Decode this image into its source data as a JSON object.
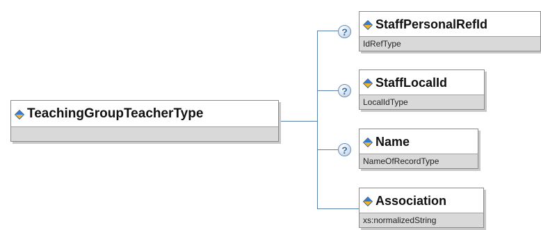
{
  "root": {
    "name": "TeachingGroupTeacherType",
    "icon": "element-icon"
  },
  "children": [
    {
      "name": "StaffPersonalRefId",
      "type": "IdRefType",
      "optional": true
    },
    {
      "name": "StaffLocalId",
      "type": "LocalIdType",
      "optional": true
    },
    {
      "name": "Name",
      "type": "NameOfRecordType",
      "optional": true
    },
    {
      "name": "Association",
      "type": "xs:normalizedString",
      "optional": false
    }
  ],
  "optional_marker": "?",
  "colors": {
    "connector": "#5a7faa",
    "subbar": "#d9d9d9",
    "border": "#8a8a8a"
  }
}
